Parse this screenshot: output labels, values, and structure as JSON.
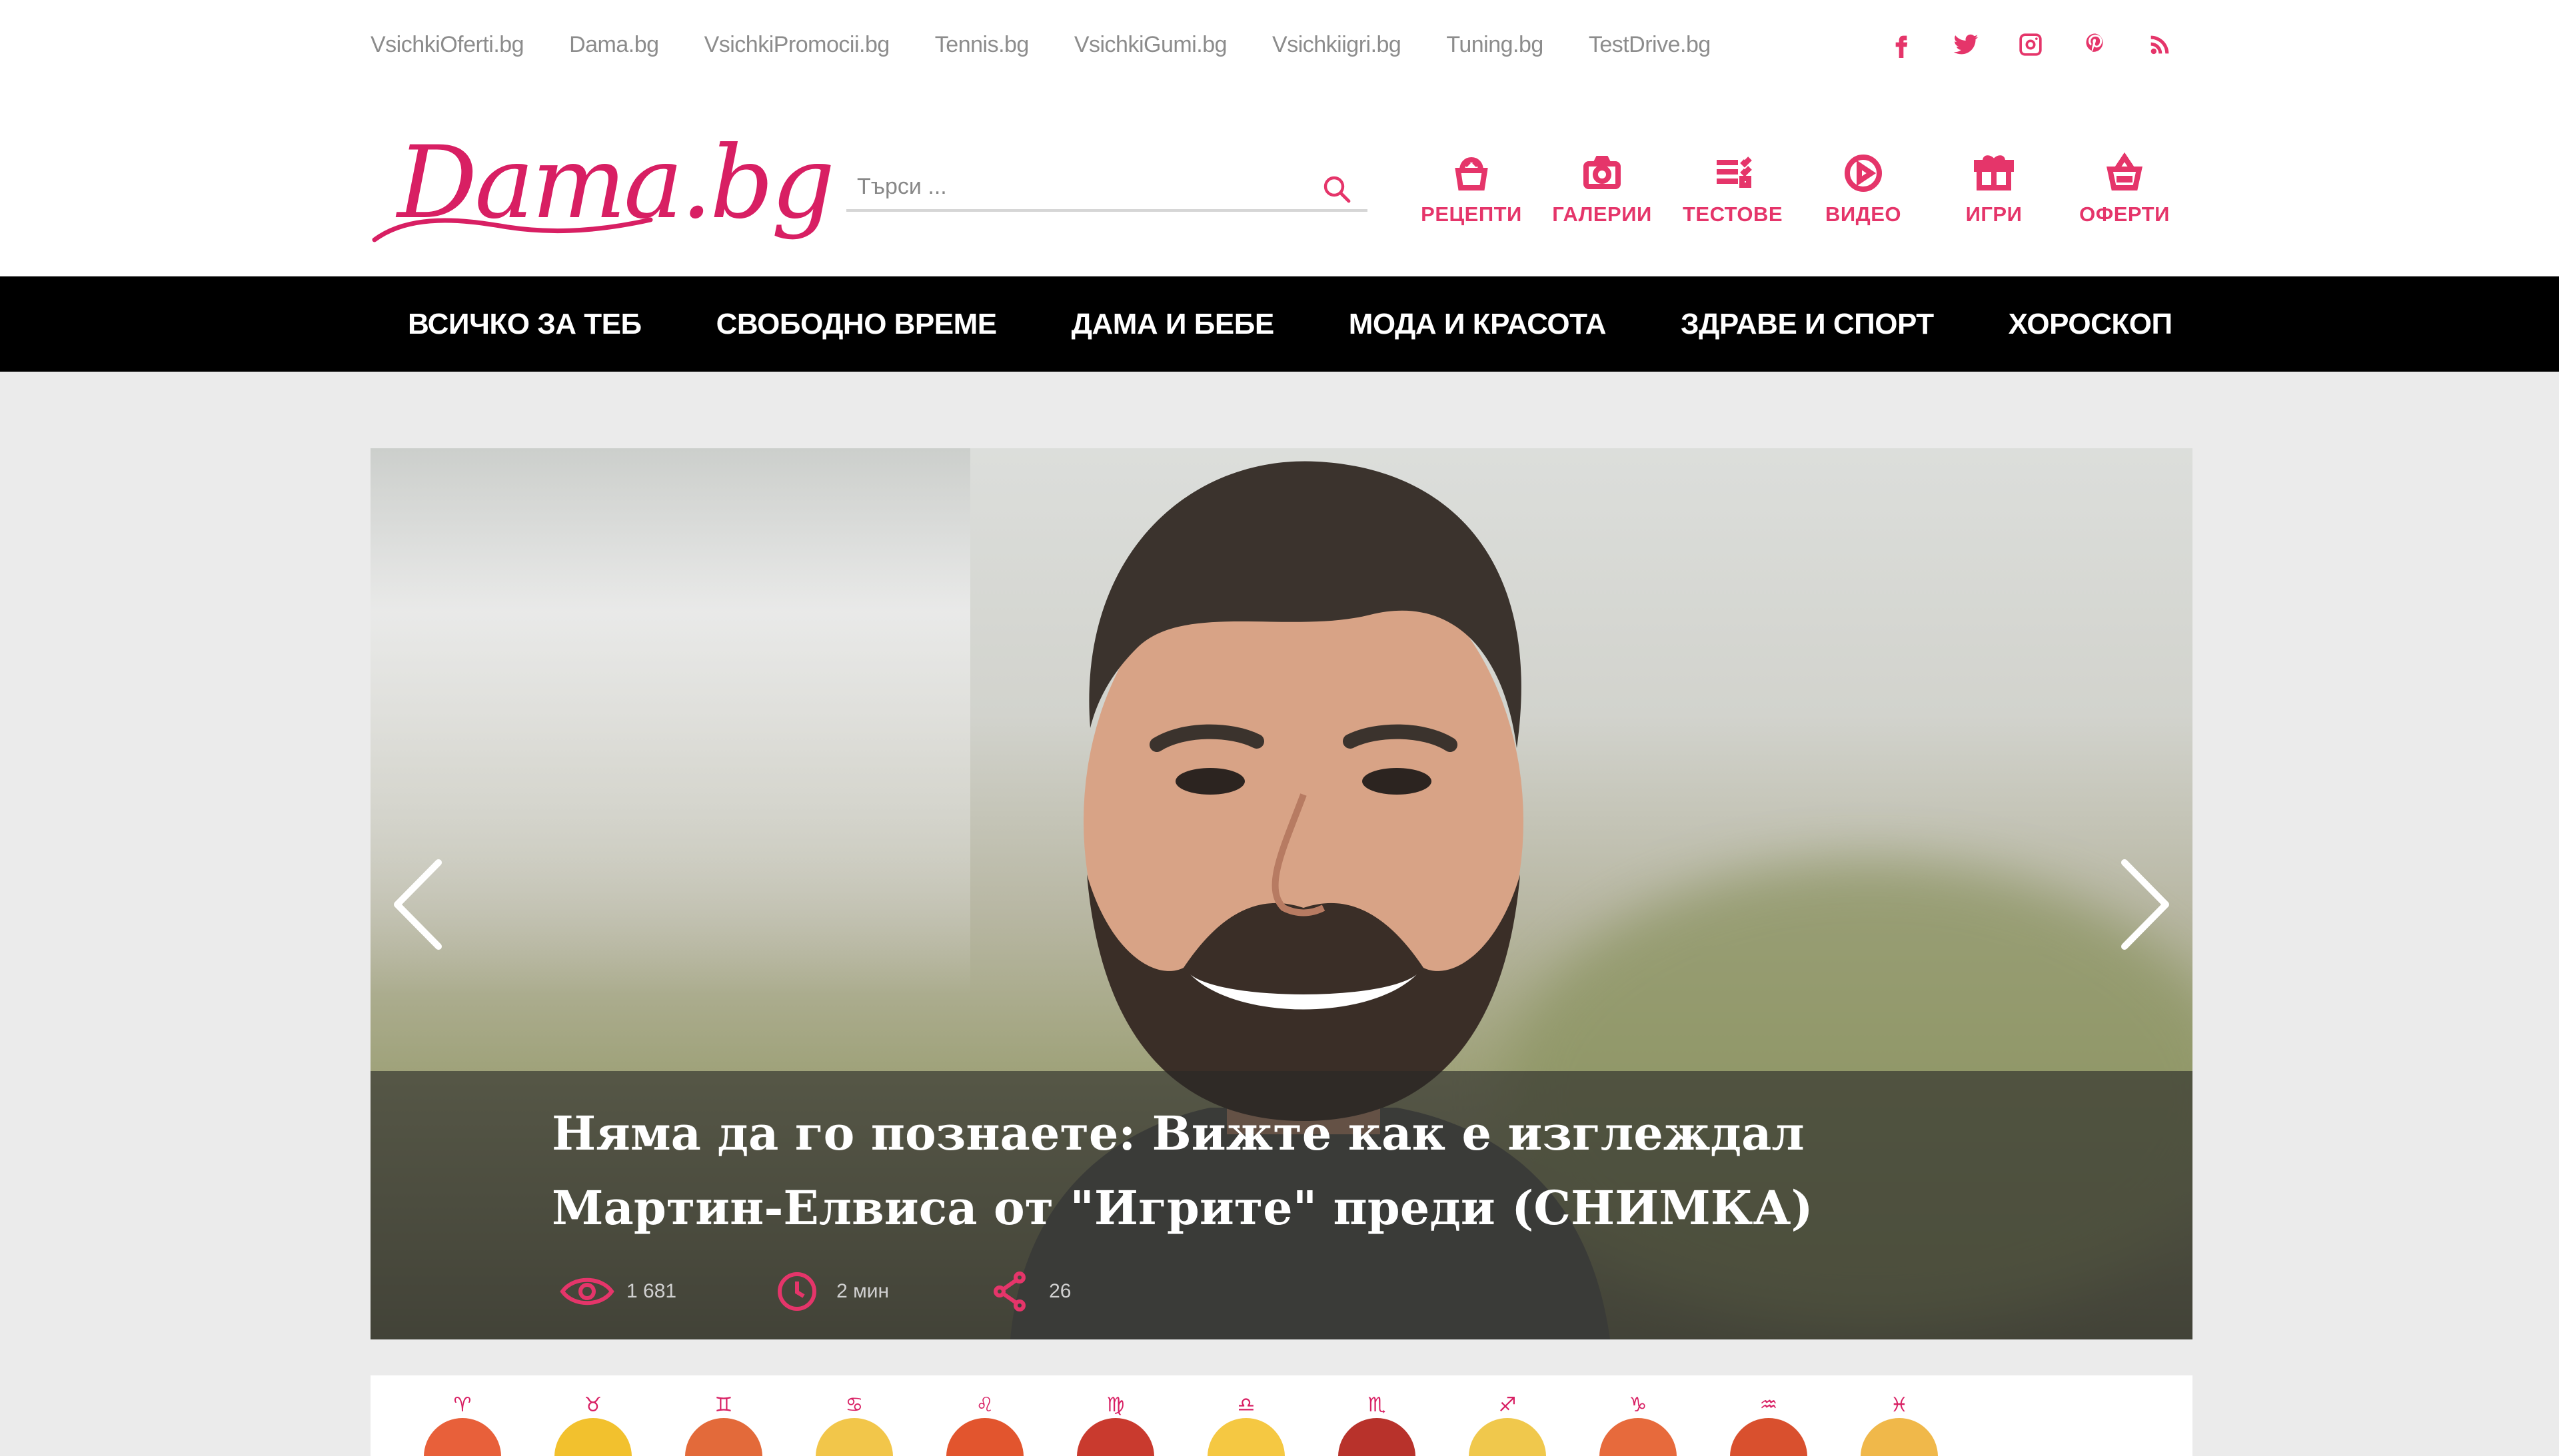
{
  "network_links": [
    "VsichkiOferti.bg",
    "Dama.bg",
    "VsichkiPromocii.bg",
    "Tennis.bg",
    "VsichkiGumi.bg",
    "Vsichkiigri.bg",
    "Tuning.bg",
    "TestDrive.bg"
  ],
  "social_icons": [
    "facebook-icon",
    "twitter-icon",
    "instagram-icon",
    "pinterest-icon",
    "rss-icon"
  ],
  "logo": {
    "text": "Dama.bg"
  },
  "search": {
    "placeholder": "Търси ..."
  },
  "quick_links": [
    {
      "label": "РЕЦЕПТИ",
      "icon": "recipes-icon"
    },
    {
      "label": "ГАЛЕРИИ",
      "icon": "camera-icon"
    },
    {
      "label": "ТЕСТОВЕ",
      "icon": "tests-icon"
    },
    {
      "label": "ВИДЕО",
      "icon": "video-icon"
    },
    {
      "label": "ИГРИ",
      "icon": "gift-icon"
    },
    {
      "label": "ОФЕРТИ",
      "icon": "basket-icon"
    }
  ],
  "main_nav": [
    "ВСИЧКО ЗА ТЕБ",
    "СВОБОДНО ВРЕМЕ",
    "ДАМА И БЕБЕ",
    "МОДА И КРАСОТА",
    "ЗДРАВЕ И СПОРТ",
    "ХОРОСКОП"
  ],
  "hero": {
    "title": "Няма да го познаете: Вижте как е изглеждал Мартин-Елвиса от \"Игрите\" преди (СНИМКА)",
    "views": "1 681",
    "read_time": "2 мин",
    "shares": "26"
  },
  "zodiac_glyphs": [
    "♈",
    "♉",
    "♊",
    "♋",
    "♌",
    "♍",
    "♎",
    "♏",
    "♐",
    "♑",
    "♒",
    "♓"
  ],
  "colors": {
    "accent": "#e5356a",
    "brand": "#d81f63",
    "nav_bg": "#000000",
    "page_bg": "#ebebeb"
  }
}
